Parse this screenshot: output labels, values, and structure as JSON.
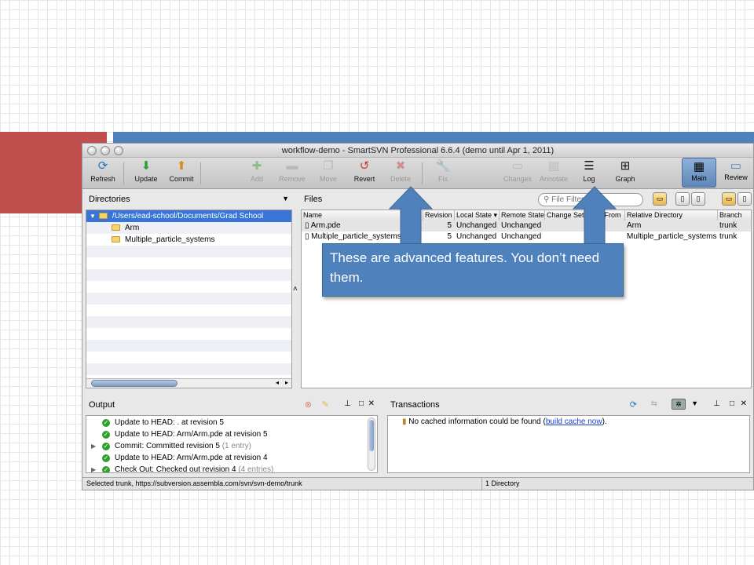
{
  "window": {
    "title": "workflow-demo - SmartSVN Professional 6.6.4 (demo until Apr 1, 2011)"
  },
  "toolbar": {
    "buttons": [
      {
        "label": "Refresh",
        "enabled": true
      },
      {
        "label": "Update",
        "enabled": true
      },
      {
        "label": "Commit",
        "enabled": true
      },
      {
        "label": "Add",
        "enabled": false
      },
      {
        "label": "Remove",
        "enabled": false
      },
      {
        "label": "Move",
        "enabled": false
      },
      {
        "label": "Revert",
        "enabled": true
      },
      {
        "label": "Delete",
        "enabled": false
      },
      {
        "label": "Fix",
        "enabled": false
      },
      {
        "label": "Changes",
        "enabled": false
      },
      {
        "label": "Annotate",
        "enabled": false
      },
      {
        "label": "Log",
        "enabled": true
      },
      {
        "label": "Graph",
        "enabled": true
      }
    ],
    "main_label": "Main",
    "review_label": "Review"
  },
  "directories": {
    "title": "Directories",
    "root": "/Users/ead-school/Documents/Grad School",
    "children": [
      "Arm",
      "Multiple_particle_systems"
    ]
  },
  "files": {
    "title": "Files",
    "search_placeholder": "File Filter",
    "columns": [
      "Name",
      "Revision",
      "Local State ▾",
      "Remote State",
      "Change Set",
      "Copy From",
      "Relative Directory",
      "Branch"
    ],
    "rows": [
      {
        "name": "Arm.pde",
        "revision": "5",
        "local_state": "Unchanged",
        "remote_state": "Unchanged",
        "relative_directory": "Arm",
        "branch": "trunk"
      },
      {
        "name": "Multiple_particle_systems.pde",
        "revision": "5",
        "local_state": "Unchanged",
        "remote_state": "Unchanged",
        "relative_directory": "Multiple_particle_systems",
        "branch": "trunk"
      }
    ]
  },
  "output": {
    "title": "Output",
    "items": [
      {
        "text": "Update to HEAD: . at revision 5",
        "note": "",
        "expandable": false
      },
      {
        "text": "Update to HEAD: Arm/Arm.pde at revision 5",
        "note": "",
        "expandable": false
      },
      {
        "text": "Commit: Committed revision 5",
        "note": "(1 entry)",
        "expandable": true
      },
      {
        "text": "Update to HEAD: Arm/Arm.pde at revision 4",
        "note": "",
        "expandable": false
      },
      {
        "text": "Check Out: Checked out revision 4",
        "note": "(4 entries)",
        "expandable": true
      }
    ]
  },
  "transactions": {
    "title": "Transactions",
    "message": "No cached information could be found (",
    "link": "build cache now",
    "message_end": ")."
  },
  "status": {
    "left": "Selected trunk, https://subversion.assembla.com/svn/svn-demo/trunk",
    "right": "1 Directory"
  },
  "callout": {
    "text": "These are advanced features. You don’t need them."
  },
  "colors": {
    "accent_blue": "#4f81bd",
    "accent_red": "#c0504d",
    "selection": "#3875d7"
  }
}
